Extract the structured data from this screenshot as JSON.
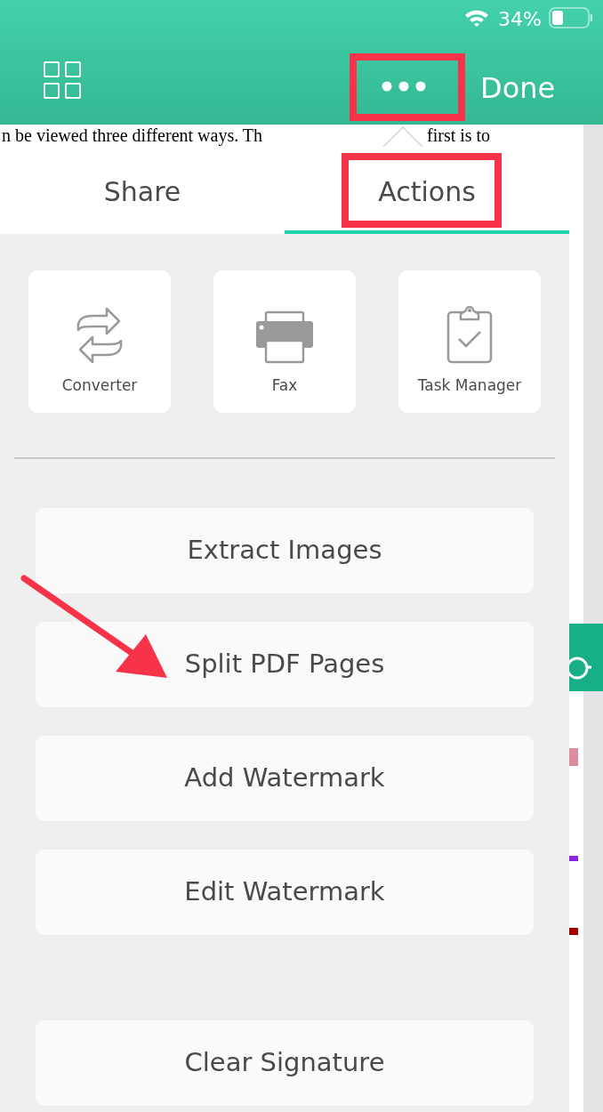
{
  "status_bar": {
    "battery": "34%"
  },
  "toolbar": {
    "done": "Done"
  },
  "document": {
    "line_left": "n be viewed three different ways. Th",
    "line_right": "first is to"
  },
  "tabs": [
    {
      "label": "Share",
      "selected": false
    },
    {
      "label": "Actions",
      "selected": true
    }
  ],
  "tools": [
    {
      "kind": "converter",
      "label": "Converter"
    },
    {
      "kind": "fax",
      "label": "Fax"
    },
    {
      "kind": "task",
      "label": "Task Manager"
    }
  ],
  "actions": [
    "Extract Images",
    "Split PDF Pages",
    "Add Watermark",
    "Edit Watermark"
  ],
  "bottom_actions": [
    "Clear Signature"
  ]
}
